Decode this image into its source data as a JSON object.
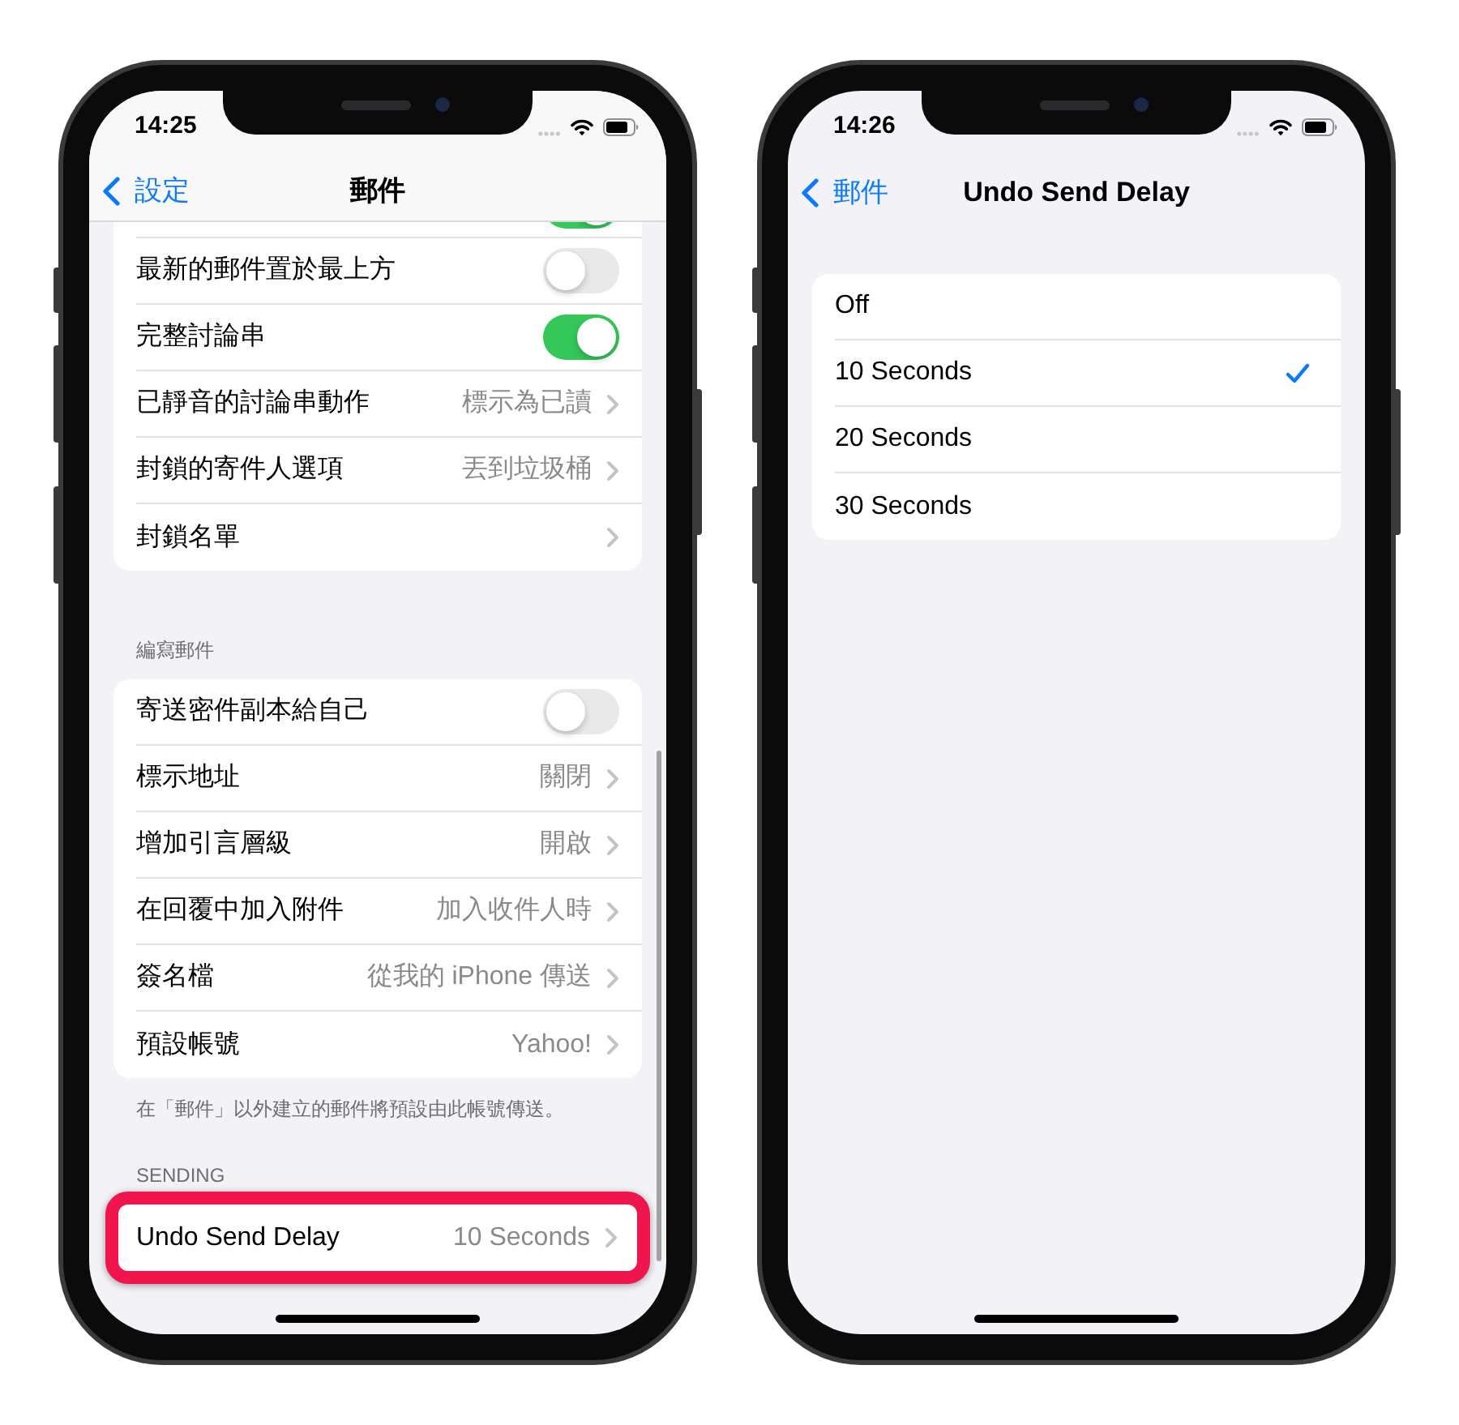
{
  "phones": [
    {
      "status_bar": {
        "time": "14:25"
      },
      "nav_bar": {
        "back": "設定",
        "title": "郵件",
        "scrolled": true
      },
      "groups": [
        {
          "rows": [
            {
              "kind": "toggle",
              "on": true
            },
            {
              "kind": "toggle",
              "label": "最新的郵件置於最上方",
              "on": false
            },
            {
              "kind": "toggle",
              "label": "完整討論串",
              "on": true
            },
            {
              "kind": "link",
              "label": "已靜音的討論串動作",
              "value": "標示為已讀"
            },
            {
              "kind": "link",
              "label": "封鎖的寄件人選項",
              "value": "丟到垃圾桶"
            },
            {
              "kind": "link",
              "label": "封鎖名單"
            }
          ]
        },
        {
          "header": "編寫郵件",
          "rows": [
            {
              "kind": "toggle",
              "label": "寄送密件副本給自己",
              "on": false
            },
            {
              "kind": "link",
              "label": "標示地址",
              "value": "關閉"
            },
            {
              "kind": "link",
              "label": "增加引言層級",
              "value": "開啟"
            },
            {
              "kind": "link",
              "label": "在回覆中加入附件",
              "value": "加入收件人時"
            },
            {
              "kind": "link",
              "label": "簽名檔",
              "value": "從我的 iPhone 傳送"
            },
            {
              "kind": "link",
              "label": "預設帳號",
              "value": "Yahoo!"
            }
          ],
          "footer": "在「郵件」以外建立的郵件將預設由此帳號傳送。"
        },
        {
          "header": "SENDING",
          "rows": [
            {
              "kind": "link",
              "label": "Undo Send Delay",
              "value": "10 Seconds",
              "highlighted": true
            }
          ]
        }
      ]
    },
    {
      "status_bar": {
        "time": "14:26"
      },
      "nav_bar": {
        "back": "郵件",
        "title": "Undo Send Delay",
        "scrolled": false
      },
      "groups": [
        {
          "rows": [
            {
              "kind": "choice",
              "label": "Off",
              "selected": false
            },
            {
              "kind": "choice",
              "label": "10 Seconds",
              "selected": true
            },
            {
              "kind": "choice",
              "label": "20 Seconds",
              "selected": false
            },
            {
              "kind": "choice",
              "label": "30 Seconds",
              "selected": false
            }
          ]
        }
      ]
    }
  ]
}
